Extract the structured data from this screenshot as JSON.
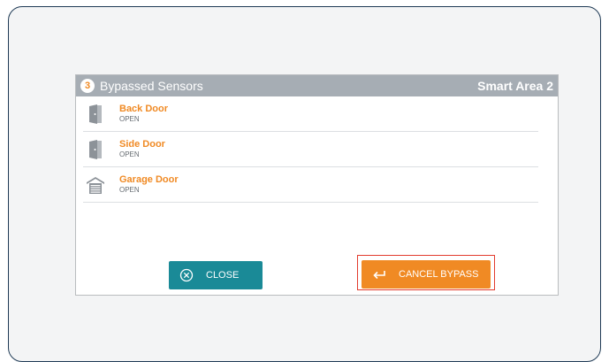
{
  "panel": {
    "count": "3",
    "title": "Bypassed Sensors",
    "area": "Smart Area 2"
  },
  "sensors": [
    {
      "name": "Back Door",
      "status": "OPEN",
      "icon": "door-icon"
    },
    {
      "name": "Side Door",
      "status": "OPEN",
      "icon": "door-icon"
    },
    {
      "name": "Garage Door",
      "status": "OPEN",
      "icon": "garage-icon"
    }
  ],
  "buttons": {
    "close_label": "CLOSE",
    "close_icon": "close-circle-icon",
    "cancel_label": "CANCEL BYPASS",
    "cancel_icon": "return-arrow-icon"
  },
  "colors": {
    "header": "#a6adb4",
    "accent": "#f08a24",
    "close_button": "#1a8a97",
    "highlight": "#e23b2e"
  }
}
